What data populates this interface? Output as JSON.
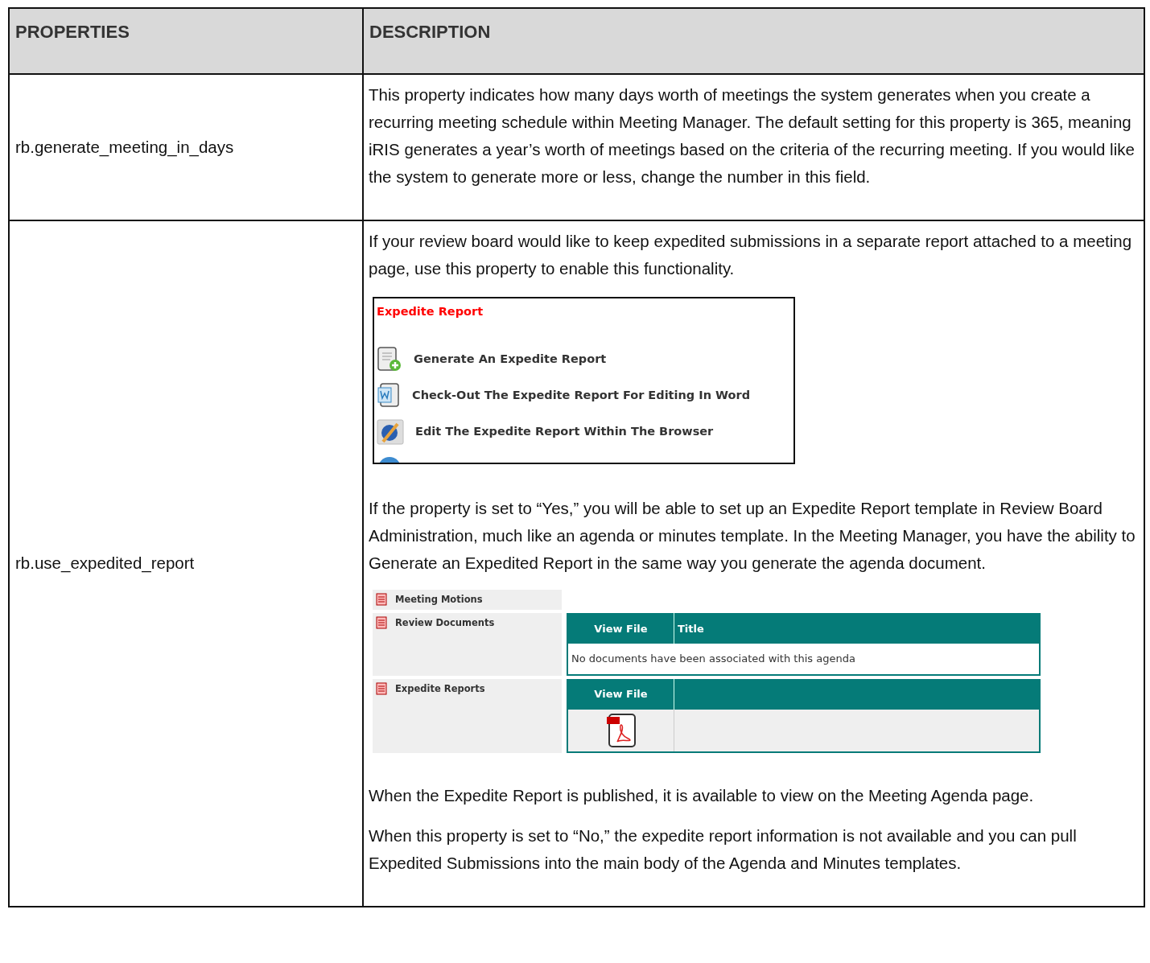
{
  "table": {
    "columns": [
      "PROPERTIES",
      "DESCRIPTION"
    ],
    "rows": [
      {
        "property": "rb.generate_meeting_in_days",
        "blocks": [
          {
            "kind": "paragraph",
            "text": "This property indicates how many days worth of meetings the system generates when you create a recurring meeting schedule within Meeting Manager. The default setting for this property is 365, meaning iRIS generates a year’s worth of meetings based on the criteria of the recurring meeting. If you would like the system to generate more or less, change the number in this field."
          }
        ]
      },
      {
        "property": "rb.use_expedited_report",
        "blocks": [
          {
            "kind": "paragraph",
            "text": "If your review board would like to keep expedited submissions in a separate report attached to a meeting page, use this property to enable this functionality."
          },
          {
            "kind": "menu_shot",
            "title": "Expedite Report",
            "items": [
              {
                "kind": "generate",
                "label": "Generate An Expedite Report"
              },
              {
                "kind": "word",
                "label": "Check-Out The Expedite Report For Editing In Word"
              },
              {
                "kind": "browser",
                "label": "Edit The Expedite Report Within The Browser"
              },
              {
                "kind": "globe"
              }
            ]
          },
          {
            "kind": "paragraph",
            "text": "If the property is set to “Yes,” you will be able to set up an Expedite Report template in Review Board Administration, much like an agenda or minutes template. In the Meeting Manager, you have the ability to Generate an Expedited Report in the same way you generate the agenda document."
          },
          {
            "kind": "agenda_shot",
            "sections": [
              {
                "label": "Meeting Motions"
              },
              {
                "label": "Review Documents",
                "grid": {
                  "columns": [
                    "View File",
                    "Title"
                  ],
                  "empty_text": "No documents have been associated with this agenda"
                }
              },
              {
                "label": "Expedite Reports",
                "grid": {
                  "columns": [
                    "View File"
                  ],
                  "files": [
                    {
                      "kind": "pdf"
                    }
                  ]
                }
              }
            ]
          },
          {
            "kind": "paragraph",
            "text": "When the Expedite Report is published, it is available to view on the Meeting Agenda page."
          },
          {
            "kind": "paragraph",
            "text": "When this property is set to “No,” the expedite report information is not available and you can pull Expedited Submissions into the main body of the Agenda and Minutes templates."
          }
        ]
      }
    ]
  }
}
